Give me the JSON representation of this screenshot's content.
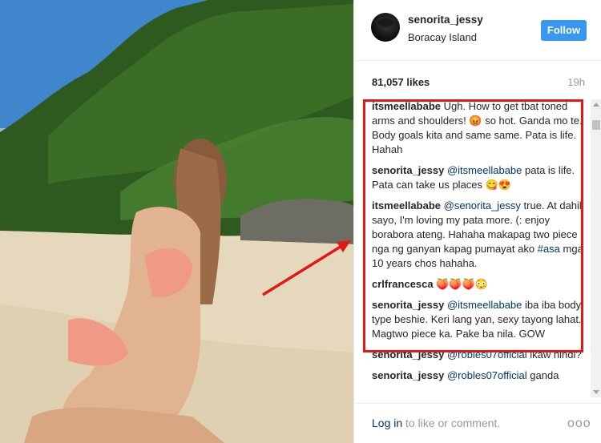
{
  "post": {
    "username": "senorita_jessy",
    "location": "Boracay Island",
    "follow_label": "Follow",
    "likes": "81,057 likes",
    "time": "19h"
  },
  "comments": [
    {
      "author": "itsmeellababe",
      "text": " Ugh. How to get tbat toned arms and shoulders! 😡 so hot. Ganda mo te. Body goals kita and same same. Pata is life. Hahah"
    },
    {
      "author": "senorita_jessy",
      "mention": "@itsmeellababe",
      "text": " pata is life. Pata can take us places 😋😍"
    },
    {
      "author": "itsmeellababe",
      "mention": "@senorita_jessy",
      "text": " true. At dahil sayo, I'm loving my pata more. (: enjoy borabora ateng. Hahaha makapag two piece nga ng ganyan kapag pumayat ako ",
      "hashtag": "#asa",
      "text2": " mga 10 years chos hahaha."
    },
    {
      "author": "crlfrancesca",
      "text": " 🍑🍑🍑😳"
    },
    {
      "author": "senorita_jessy",
      "mention": "@itsmeellababe",
      "text": " iba iba body type beshie. Keri lang yan, sexy tayong lahat. Magtwo piece ka. Pake ba nila. GOW"
    },
    {
      "author": "senorita_jessy",
      "mention": "@robles07official",
      "text": " ikaw hindi?"
    },
    {
      "author": "senorita_jessy",
      "mention": "@robles07official",
      "text": " ganda"
    }
  ],
  "footer": {
    "login_link": "Log in",
    "login_rest": " to like or comment.",
    "more": "ooo"
  },
  "colors": {
    "follow_blue": "#3897f0",
    "link_blue": "#003569",
    "highlight_red": "#e01818"
  }
}
